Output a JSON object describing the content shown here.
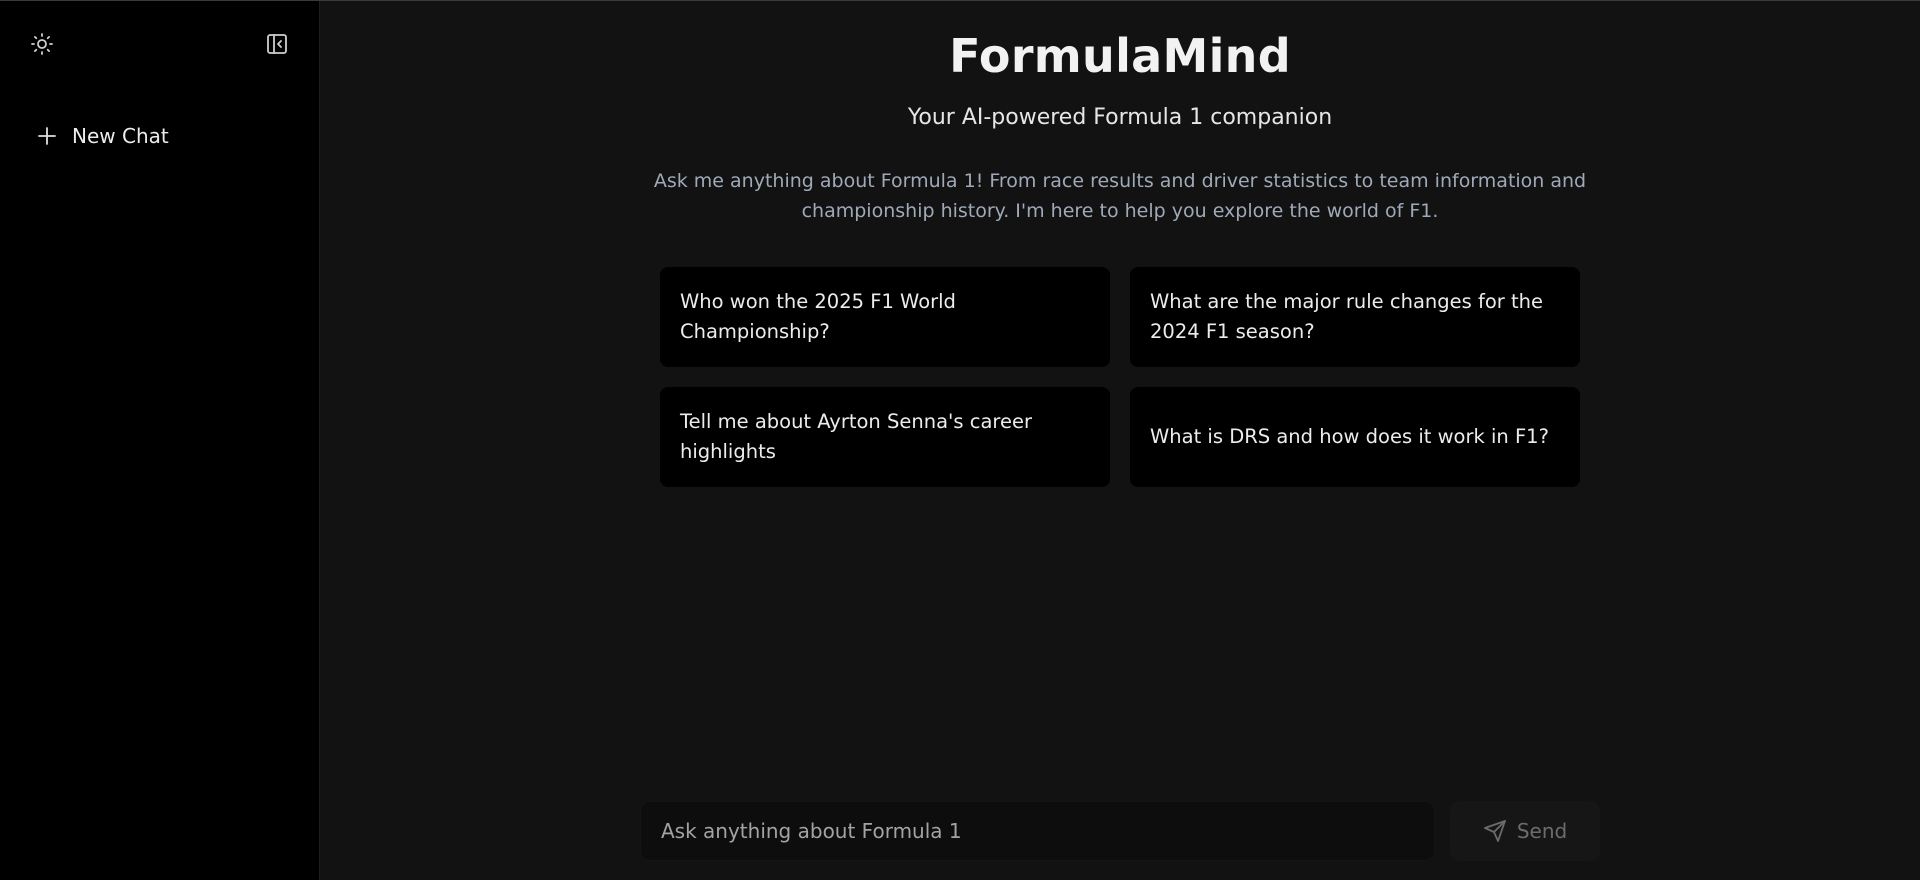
{
  "sidebar": {
    "theme_icon": "sun-icon",
    "collapse_icon": "sidebar-collapse-icon",
    "new_chat": {
      "icon": "plus-icon",
      "label": "New Chat"
    }
  },
  "main": {
    "title": "FormulaMind",
    "subtitle": "Your AI-powered Formula 1 companion",
    "description": "Ask me anything about Formula 1! From race results and driver statistics to team information and championship history. I'm here to help you explore the world of F1.",
    "suggestions": [
      "Who won the 2025 F1 World Championship?",
      "What are the major rule changes for the 2024 F1 season?",
      "Tell me about Ayrton Senna's career highlights",
      "What is DRS and how does it work in F1?"
    ]
  },
  "composer": {
    "placeholder": "Ask anything about Formula 1",
    "value": "",
    "send_label": "Send",
    "send_icon": "send-icon"
  },
  "colors": {
    "sidebar_bg": "#000000",
    "main_bg": "#121212",
    "card_bg": "#000000",
    "description_text": "#9fa9b8",
    "send_disabled_text": "#6c6c6c"
  }
}
